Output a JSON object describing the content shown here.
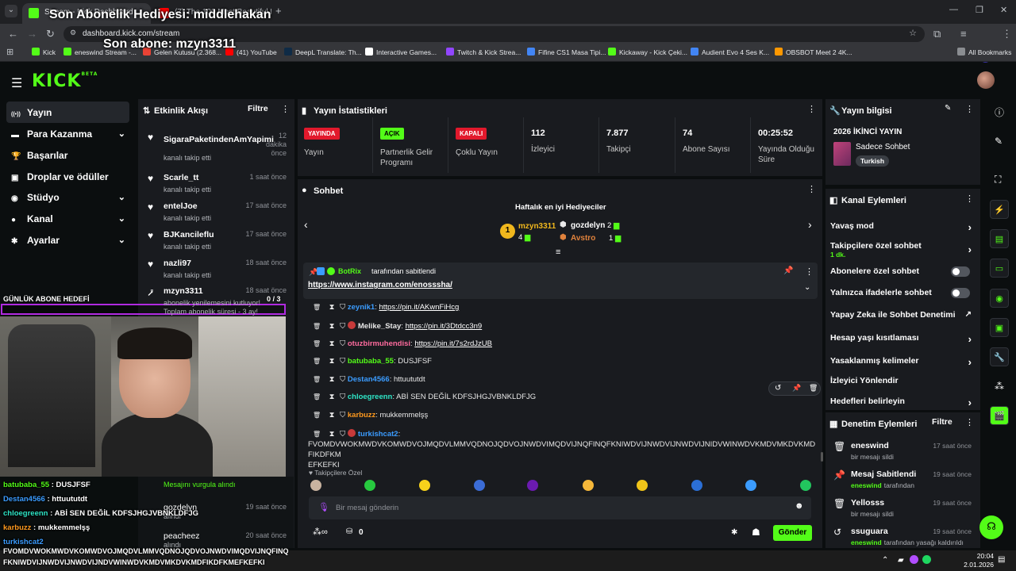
{
  "browser": {
    "tabs": [
      {
        "label": "Stream - Kick Dashboard",
        "favicon_color": "#53fc18"
      },
      {
        "label": "(7) The 100 Most Beautiful Fre",
        "favicon_color": "#ff0000"
      }
    ],
    "url": "dashboard.kick.com/stream",
    "bookmarks": [
      {
        "label": "Kick",
        "color": "#53fc18"
      },
      {
        "label": "eneswind Stream -...",
        "color": "#53fc18"
      },
      {
        "label": "Gelen Kutusu (2.368...",
        "color": "#ea4335"
      },
      {
        "label": "(41) YouTube",
        "color": "#ff0000"
      },
      {
        "label": "DeepL Translate: Th...",
        "color": "#0f2b46"
      },
      {
        "label": "Interactive Games...",
        "color": "#ffffff"
      },
      {
        "label": "Twitch & Kick Strea...",
        "color": "#9146ff"
      },
      {
        "label": "Fifine CS1 Masa Tipi...",
        "color": "#4285f4"
      },
      {
        "label": "Kickaway - Kick Çeki...",
        "color": "#53fc18"
      },
      {
        "label": "Audient Evo 4 Ses K...",
        "color": "#4285f4"
      },
      {
        "label": "OBSBOT Meet 2 4K...",
        "color": "#ff9800"
      }
    ],
    "all_bookmarks": "All Bookmarks"
  },
  "overlay": {
    "gift_text": "Son Abonelik Hediyesi: middlehakan",
    "sub_text": "Son abone: mzyn3311",
    "goal_label": "GÜNLÜK ABONE HEDEFİ",
    "goal_value": "0 / 3",
    "chat": [
      {
        "user": "batubaba_55",
        "text": "DUSJFSF",
        "color": "#53fc18"
      },
      {
        "user": "Destan4566",
        "text": "httuututdt",
        "color": "#3b9cff"
      },
      {
        "user": "chloegreenn",
        "text": "ABİ SEN DEĞİL KDFSJHGJVBNKLDFJG",
        "color": "#2ee5c6"
      },
      {
        "user": "karbuzz",
        "text": "mukkemmelşş",
        "color": "#ff9a1f"
      },
      {
        "user": "turkishcat2",
        "text": "",
        "color": "#3b9cff"
      }
    ],
    "long_msg_1": "FVOMDVWOKMWDVKOMWDVOJMQDVLMMVQDNOJQDVOJNWDVIMQDVIJNQFINQ",
    "long_msg_2": "FKNIWDVIJNWDVIJNWDVIJNDVWINWDVKMDVMKDVKMDFIKDFKMEFKEFKI"
  },
  "kick": {
    "logo": "KICK",
    "beta": "BETA"
  },
  "sidebar": {
    "items": [
      {
        "label": "Yayın",
        "icon": "broadcast-icon",
        "glyph": "((•))",
        "chevron": false
      },
      {
        "label": "Para Kazanma",
        "icon": "money-icon",
        "glyph": "▬",
        "chevron": true
      },
      {
        "label": "Başarılar",
        "icon": "trophy-icon",
        "glyph": "🏆",
        "chevron": false
      },
      {
        "label": "Droplar ve ödüller",
        "icon": "gift-icon",
        "glyph": "▣",
        "chevron": false
      },
      {
        "label": "Stüdyo",
        "icon": "studio-icon",
        "glyph": "◉",
        "chevron": true
      },
      {
        "label": "Kanal",
        "icon": "user-icon",
        "glyph": "●",
        "chevron": true
      },
      {
        "label": "Ayarlar",
        "icon": "gear-icon",
        "glyph": "✱",
        "chevron": true
      }
    ]
  },
  "activity": {
    "title": "Etkinlik Akışı",
    "filter": "Filtre",
    "events": [
      {
        "name": "SigaraPaketindenAmYapimi",
        "sub": "kanalı takip etti",
        "time": "12 dakika önce"
      },
      {
        "name": "Scarle_tt",
        "sub": "kanalı takip etti",
        "time": "1 saat önce"
      },
      {
        "name": "entelJoe",
        "sub": "kanalı takip etti",
        "time": "17 saat önce"
      },
      {
        "name": "BJKancileflu",
        "sub": "kanalı takip etti",
        "time": "17 saat önce"
      },
      {
        "name": "nazli97",
        "sub": "kanalı takip etti",
        "time": "18 saat önce"
      },
      {
        "name": "mzyn3311",
        "sub": "abonelik yenilemesini kutluyor! Toplam abonelik süresi - 3 ay!",
        "time": "18 saat önce"
      }
    ],
    "lower": [
      {
        "name": "",
        "sub": "Mesajını vurgula alındı",
        "time": ""
      },
      {
        "name": "gozdelyn",
        "sub": "alındı",
        "time": "19 saat önce"
      },
      {
        "name": "peacheez",
        "sub": "alındı",
        "time": "20 saat önce"
      }
    ]
  },
  "stats": {
    "title": "Yayın İstatistikleri",
    "items": [
      {
        "badge": "YAYINDA",
        "badge_color": "#e2192c",
        "label": "Yayın"
      },
      {
        "badge": "AÇIK",
        "badge_color": "#53fc18",
        "label": "Partnerlik Gelir Programı"
      },
      {
        "badge": "KAPALI",
        "badge_color": "#e2192c",
        "label": "Çoklu Yayın"
      },
      {
        "value": "112",
        "label": "İzleyici"
      },
      {
        "value": "7.877",
        "label": "Takipçi"
      },
      {
        "value": "74",
        "label": "Abone Sayısı"
      },
      {
        "value": "00:25:52",
        "label": "Yayında Olduğu Süre"
      }
    ]
  },
  "chat": {
    "title": "Sohbet",
    "top_gifters_title": "Haftalık en iyi Hediyeciler",
    "gifters": [
      {
        "rank": "1",
        "name": "mzyn3311",
        "count": "4"
      },
      {
        "name": "gozdelyn",
        "count": "2"
      },
      {
        "name": "Avstro",
        "count": "1"
      }
    ],
    "pinned_by": "BotRix",
    "pinned_suffix": "tarafından sabitlendi",
    "pinned_link": "https://www.instagram.com/enosssha/",
    "messages": [
      {
        "user": "zeynik1",
        "text": "https://pin.it/AKwnFiHcg",
        "link": true,
        "color": "#3b9cff"
      },
      {
        "user": "Melike_Stay",
        "text": "https://pin.it/3Dtdcc3n9",
        "link": true,
        "color": "#e8e8e8"
      },
      {
        "user": "otuzbirmuhendisi",
        "text": "https://pin.it/7s2rdJzUB",
        "link": true,
        "color": "#ff6b9e"
      },
      {
        "user": "batubaba_55",
        "text": "DUSJFSF",
        "link": false,
        "color": "#53fc18"
      },
      {
        "user": "Destan4566",
        "text": "httuututdt",
        "link": false,
        "color": "#3b9cff"
      },
      {
        "user": "chloegreenn",
        "text": "ABİ SEN DEĞİL KDFSJHGJVBNKLDFJG",
        "link": false,
        "color": "#2ee5c6"
      },
      {
        "user": "karbuzz",
        "text": "mukkemmelşş",
        "link": false,
        "color": "#ff9a1f"
      },
      {
        "user": "turkishcat2",
        "text": "",
        "link": false,
        "color": "#3b9cff"
      }
    ],
    "long_line_1": "FVOMDVWOKMWDVKOMWDVOJMQDVLMMVQDNOJQDVOJNWDVIMQDVIJNQFINQFKNIWDVIJNWDVIJNWDVIJNIDVWINWDVKMDVMKDVKMDFIKDFKM",
    "long_line_2": "EFKEFKI",
    "followers_only": "Takipçilere Özel",
    "input_placeholder": "Bir mesaj gönderin",
    "points": "0",
    "send": "Gönder"
  },
  "stream_info": {
    "title": "Yayın bilgisi",
    "stream_title": "2026 İKİNCİ YAYIN",
    "category": "Sadece Sohbet",
    "tag": "Turkish"
  },
  "channel_actions": {
    "title": "Kanal Eylemleri",
    "items": [
      {
        "label": "Yavaş mod",
        "kind": "chevron",
        "sub": ""
      },
      {
        "label": "Takipçilere özel sohbet",
        "kind": "chevron",
        "sub": "1 dk."
      },
      {
        "label": "Abonelere özel sohbet",
        "kind": "toggle",
        "sub": ""
      },
      {
        "label": "Yalnızca ifadelerle sohbet",
        "kind": "toggle",
        "sub": ""
      },
      {
        "label": "Yapay Zeka ile Sohbet Denetimi",
        "kind": "external",
        "sub": ""
      },
      {
        "label": "Hesap yaşı kısıtlaması",
        "kind": "chevron",
        "sub": ""
      },
      {
        "label": "Yasaklanmış kelimeler",
        "kind": "chevron",
        "sub": ""
      },
      {
        "label": "İzleyici Yönlendir",
        "kind": "none",
        "sub": ""
      },
      {
        "label": "Hedefleri belirleyin",
        "kind": "chevron",
        "sub": ""
      }
    ]
  },
  "moderation": {
    "title": "Denetim Eylemleri",
    "filter": "Filtre",
    "items": [
      {
        "icon": "trash-icon",
        "glyph": "🗑",
        "name": "eneswind",
        "sub": "bir mesajı sildi",
        "time": "17 saat önce",
        "sub_user": ""
      },
      {
        "icon": "pin-icon",
        "glyph": "📌",
        "name": "Mesaj Sabitlendi",
        "sub": "tarafından",
        "time": "19 saat önce",
        "sub_user": "eneswind"
      },
      {
        "icon": "trash-icon",
        "glyph": "🗑",
        "name": "Yellosss",
        "sub": "bir mesajı sildi",
        "time": "19 saat önce",
        "sub_user": ""
      },
      {
        "icon": "undo-icon",
        "glyph": "↺",
        "name": "ssuguara",
        "sub": "tarafından yasağı kaldırıldı",
        "time": "19 saat önce",
        "sub_user": "eneswind"
      }
    ]
  },
  "taskbar": {
    "time": "20:04",
    "date": "2.01.2026"
  }
}
